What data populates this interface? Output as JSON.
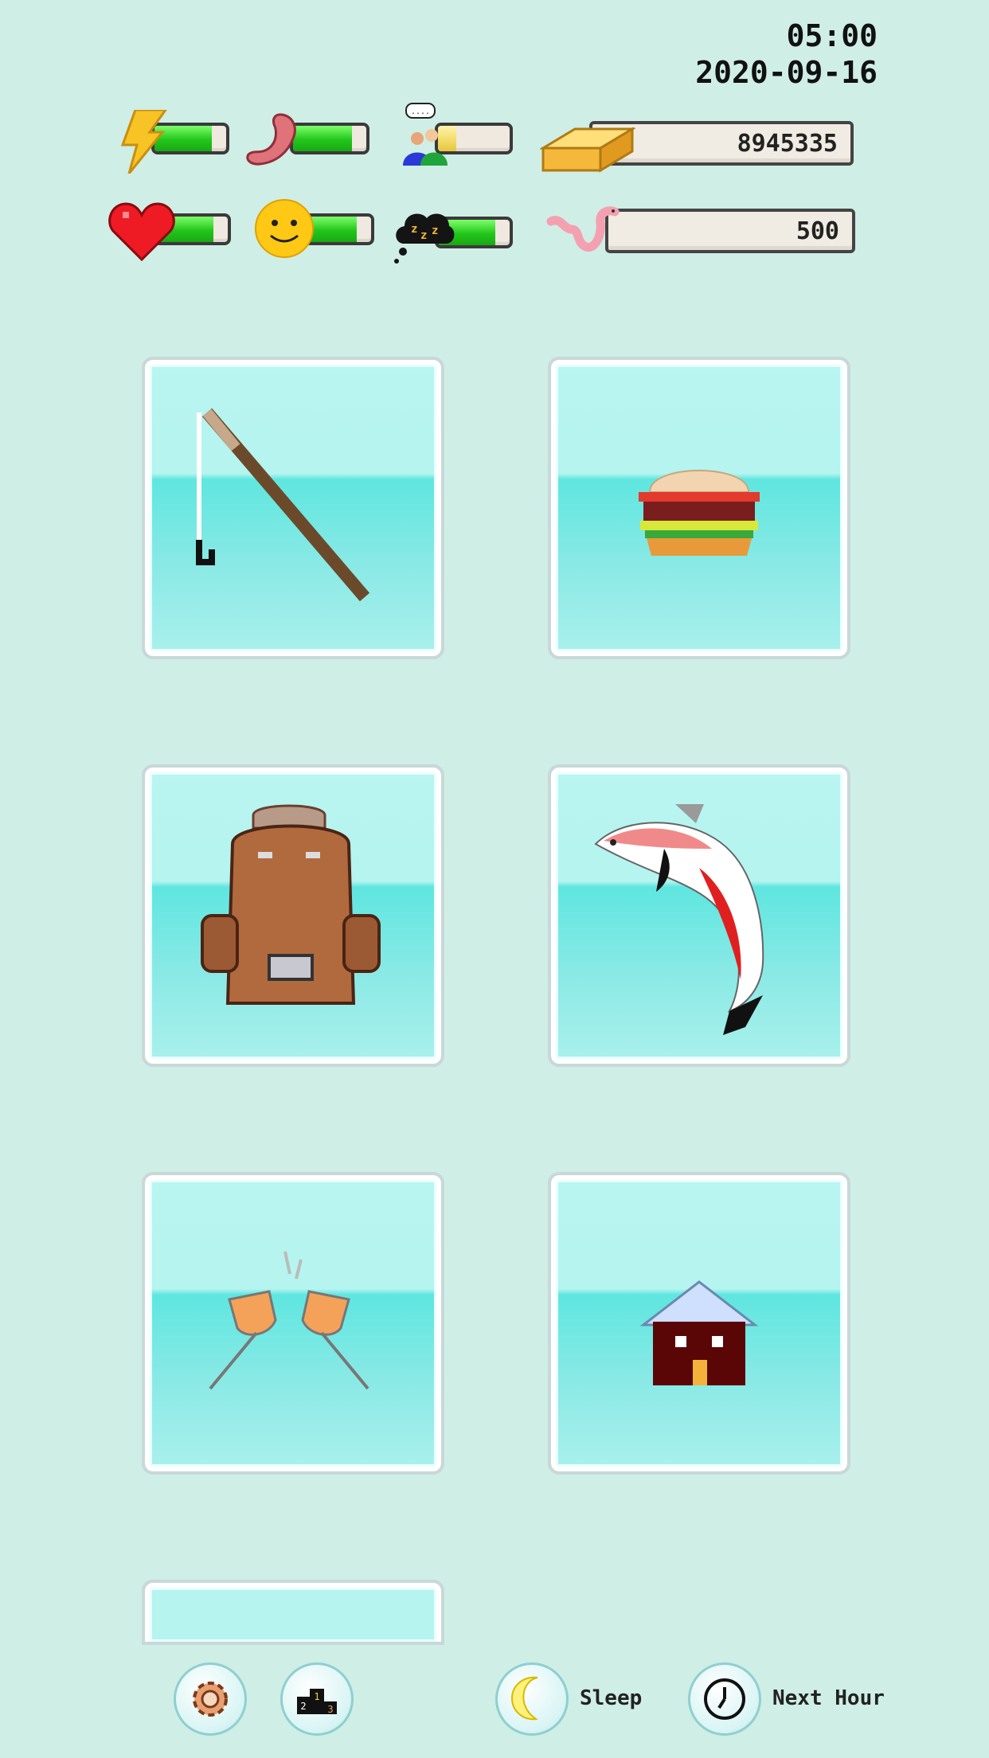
{
  "clock": {
    "time": "05:00",
    "date": "2020-09-16"
  },
  "stats": {
    "energy": {
      "icon": "lightning-icon",
      "level": 0.8
    },
    "hunger": {
      "icon": "stomach-icon",
      "level": 0.8
    },
    "social": {
      "icon": "people-chat-icon",
      "level": 0.25
    },
    "health": {
      "icon": "heart-icon",
      "level": 0.8
    },
    "mood": {
      "icon": "smiley-icon",
      "level": 0.8
    },
    "sleep": {
      "icon": "zzz-cloud-icon",
      "level": 0.8
    }
  },
  "resources": {
    "gold": {
      "icon": "gold-bar-icon",
      "value": "8945335"
    },
    "bait": {
      "icon": "worm-icon",
      "value": "500"
    }
  },
  "tiles": [
    {
      "icon": "fishing-rod-icon"
    },
    {
      "icon": "burger-icon"
    },
    {
      "icon": "backpack-icon"
    },
    {
      "icon": "koi-fish-icon"
    },
    {
      "icon": "cheers-glasses-icon"
    },
    {
      "icon": "house-icon"
    },
    {
      "icon": "empty"
    }
  ],
  "bottom": {
    "settings_icon": "gear-icon",
    "leaderboard_icon": "podium-icon",
    "sleep_label": "Sleep",
    "next_hour_label": "Next Hour"
  },
  "colors": {
    "background": "#cfeee6",
    "bar_fill": "#22c61b",
    "social_fill": "#f4dc6a",
    "tile_water": "#5fe6e0"
  }
}
